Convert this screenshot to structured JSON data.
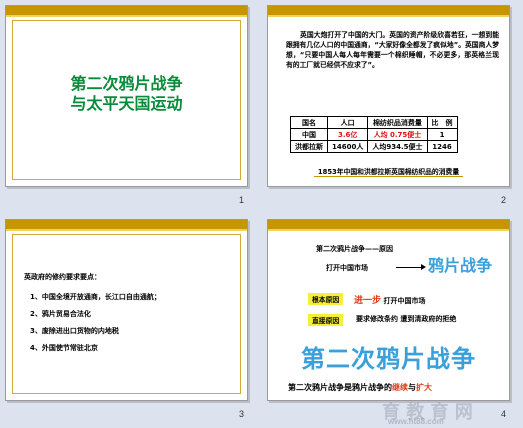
{
  "slides": [
    {
      "number": "1",
      "title_line1": "第二次鸦片战争",
      "title_line2": "与太平天国运动"
    },
    {
      "number": "2",
      "paragraph": "英国大炮打开了中国的大门。英国的资产阶级欣喜若狂，一想到能跟拥有几亿人口的中国通商，“大家好像全都发了疯似地”。英国商人梦想，“只要中国人每人每年需要一个棉织睡帽，不必更多，那英格兰现有的工厂就已经供不应求了”。",
      "table": {
        "headers": [
          "国名",
          "人口",
          "棉纺织品消费量",
          "比　例"
        ],
        "rows": [
          [
            "中国",
            "3.6亿",
            "人均 0.75便士",
            "1"
          ],
          [
            "洪都拉斯",
            "14600人",
            "人均934.5便士",
            "1246"
          ]
        ]
      },
      "caption": "1853年中国和洪都拉斯英国棉纺织品的消费量"
    },
    {
      "number": "3",
      "heading": "英政府的修约要求要点：",
      "items": [
        "1、中国全境开放通商，长江口自由通航；",
        "2、鸦片贸易合法化",
        "3、废除进出口货物的内地税",
        "4、外国使节常驻北京"
      ]
    },
    {
      "number": "4",
      "heading": "第二次鸦片战争——原因",
      "open_market": "打开中国市场",
      "big_word": "鸦片战争",
      "root_label": "根本原因",
      "root_text_red": "进一步",
      "root_text": "打开中国市场",
      "direct_label": "直接原因",
      "direct_text": "要求修改条约 遭到清政府的拒绝",
      "title": "第二次鸦片战争",
      "conclusion_prefix": "第二次鸦片战争是鸦片战争的",
      "conclusion_red1": "继续",
      "conclusion_mid": "与",
      "conclusion_red2": "扩大",
      "watermark": "育 教 育 网",
      "watermark_url": "www.ht88.com"
    }
  ]
}
